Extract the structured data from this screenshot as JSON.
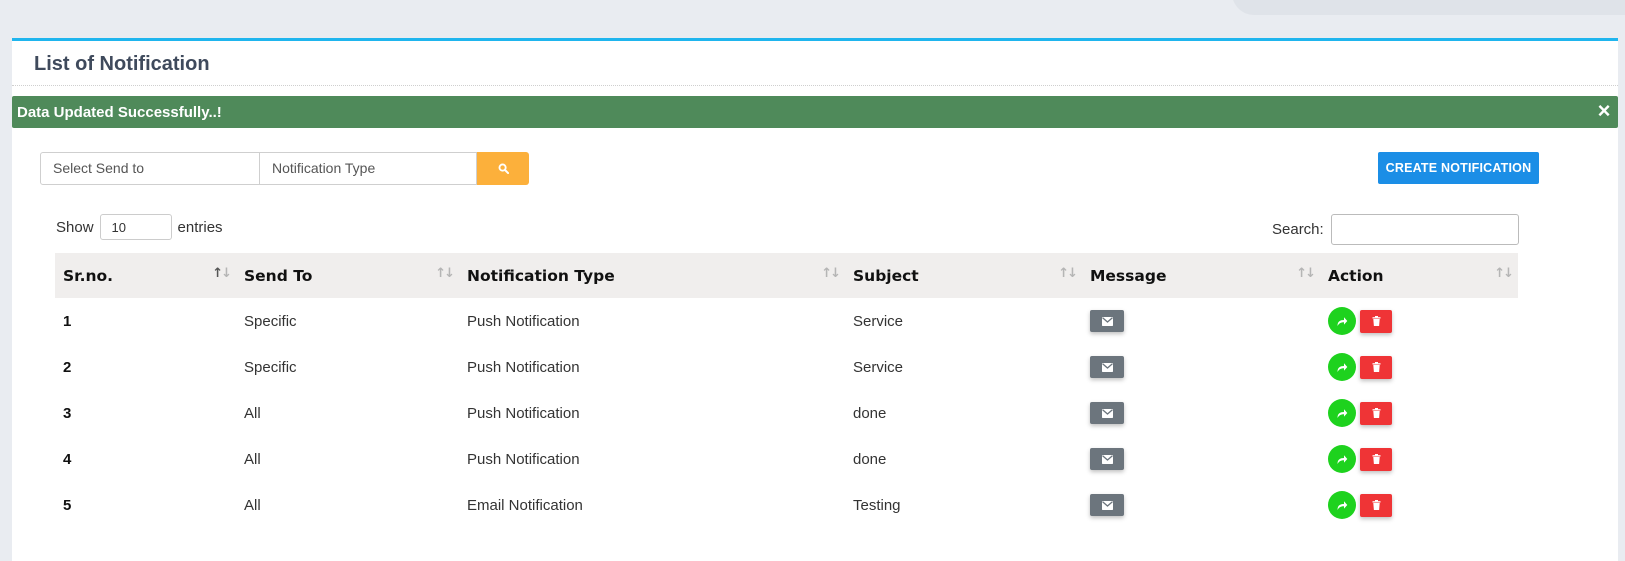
{
  "page": {
    "title": "List of Notification"
  },
  "alert": {
    "message": "Data Updated Successfully..!",
    "close_label": "×",
    "color": "#4f8a5a"
  },
  "filters": {
    "send_to_placeholder": "Select Send to",
    "type_placeholder": "Notification Type",
    "search_icon": "search-icon"
  },
  "create_button": {
    "label": "CREATE NOTIFICATION",
    "color": "#1b8ee6"
  },
  "table_controls": {
    "show_label": "Show",
    "entries_value": "10",
    "entries_label": "entries",
    "search_label": "Search:"
  },
  "table": {
    "columns": [
      "Sr.no.",
      "Send To",
      "Notification Type",
      "Subject",
      "Message",
      "Action"
    ],
    "rows": [
      {
        "sr": "1",
        "send_to": "Specific",
        "type": "Push Notification",
        "subject": "Service"
      },
      {
        "sr": "2",
        "send_to": "Specific",
        "type": "Push Notification",
        "subject": "Service"
      },
      {
        "sr": "3",
        "send_to": "All",
        "type": "Push Notification",
        "subject": "done"
      },
      {
        "sr": "4",
        "send_to": "All",
        "type": "Push Notification",
        "subject": "done"
      },
      {
        "sr": "5",
        "send_to": "All",
        "type": "Email Notification",
        "subject": "Testing"
      }
    ],
    "row_icons": {
      "message": "envelope-icon",
      "forward": "share-icon",
      "delete": "trash-icon"
    }
  },
  "colors": {
    "accent_border": "#1fb5ee",
    "search_button": "#fcb03b",
    "forward": "#1ed21e",
    "delete": "#ef3436",
    "message": "#6c757d"
  }
}
